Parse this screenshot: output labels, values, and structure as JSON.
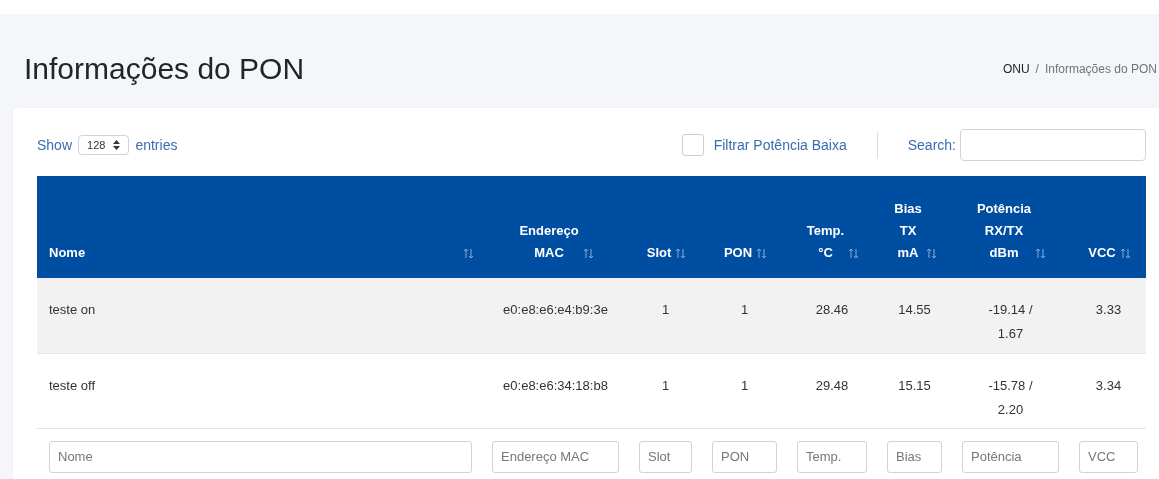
{
  "page": {
    "title": "Informações do PON"
  },
  "breadcrumb": [
    {
      "label": "ONU",
      "kind": "link"
    },
    {
      "label": "/",
      "kind": "separator"
    },
    {
      "label": "Informações do PON",
      "kind": "current"
    }
  ],
  "controls": {
    "show_label": "Show",
    "page_size": "128",
    "entries_label": "entries",
    "filter_checkbox": {
      "label": "Filtrar Potência Baixa",
      "checked": false
    },
    "search_label": "Search:"
  },
  "table": {
    "columns": [
      {
        "lines": [
          "Nome"
        ]
      },
      {
        "lines": [
          "Endereço",
          "MAC"
        ]
      },
      {
        "lines": [
          "Slot"
        ]
      },
      {
        "lines": [
          "PON"
        ]
      },
      {
        "lines": [
          "Temp.",
          "°C"
        ]
      },
      {
        "lines": [
          "Bias",
          "TX",
          "mA"
        ]
      },
      {
        "lines": [
          "Potência",
          "RX/TX",
          "dBm"
        ]
      },
      {
        "lines": [
          "VCC"
        ]
      }
    ],
    "rows": [
      {
        "cells": [
          "teste on",
          "e0:e8:e6:e4:b9:3e",
          "1",
          "1",
          "28.46",
          "14.55",
          "-19.14 / 1.67",
          "3.33"
        ]
      },
      {
        "cells": [
          "teste off",
          "e0:e8:e6:34:18:b8",
          "1",
          "1",
          "29.48",
          "15.15",
          "-15.78 / 2.20",
          "3.34"
        ]
      }
    ],
    "filters": [
      {
        "placeholder": "Nome"
      },
      {
        "placeholder": "Endereço MAC"
      },
      {
        "placeholder": "Slot"
      },
      {
        "placeholder": "PON"
      },
      {
        "placeholder": "Temp."
      },
      {
        "placeholder": "Bias"
      },
      {
        "placeholder": "Potência"
      },
      {
        "placeholder": "VCC"
      }
    ]
  }
}
